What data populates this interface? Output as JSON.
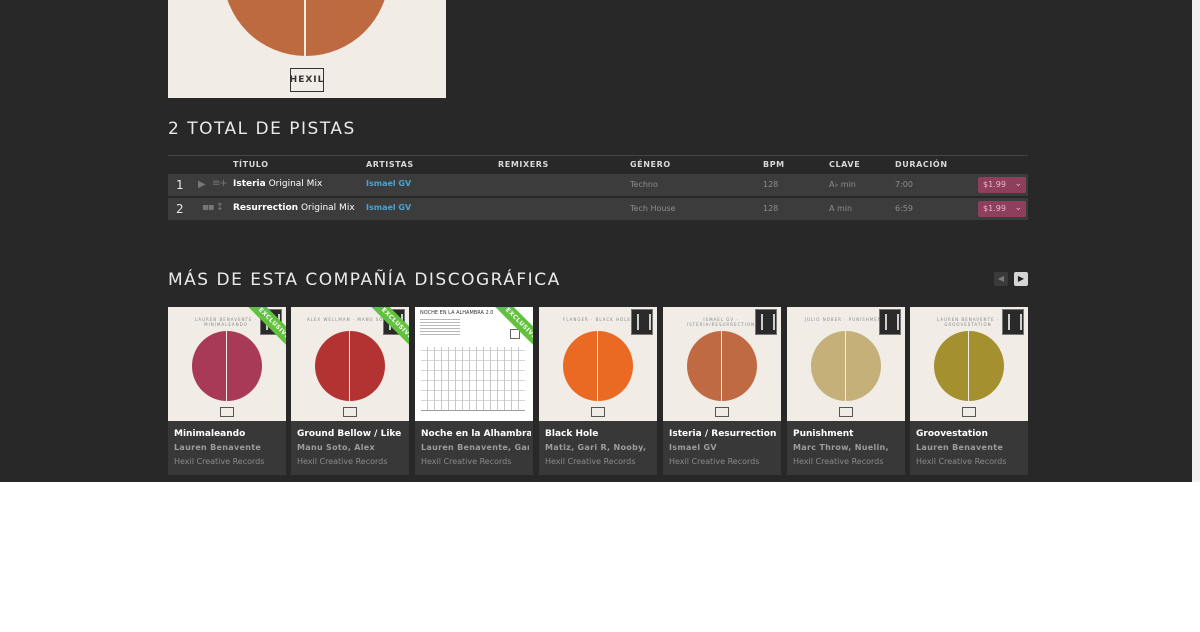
{
  "hero": {
    "logo_text": "HEXIL"
  },
  "tracks_section": {
    "title": "2 TOTAL DE PISTAS"
  },
  "table": {
    "headers": {
      "title": "TÍTULO",
      "artists": "ARTISTAS",
      "remixers": "REMIXERS",
      "genre": "GÉNERO",
      "bpm": "BPM",
      "key": "CLAVE",
      "duration": "DURACIÓN"
    },
    "rows": [
      {
        "num": "1",
        "name": "Isteria",
        "mix": "Original Mix",
        "artist": "Ismael GV",
        "genre": "Techno",
        "bpm": "128",
        "key": "A♭ min",
        "duration": "7:00",
        "price": "$1.99"
      },
      {
        "num": "2",
        "name": "Resurrection",
        "mix": "Original Mix",
        "artist": "Ismael GV",
        "genre": "Tech House",
        "bpm": "128",
        "key": "A min",
        "duration": "6:59",
        "price": "$1.99"
      }
    ]
  },
  "label_section": {
    "title": "MÁS DE ESTA COMPAÑÍA DISCOGRÁFICA"
  },
  "releases": [
    {
      "title": "Minimaleando",
      "artist": "Lauren Benavente",
      "label": "Hexil Creative Records",
      "cover_tag": "LAUREN BENAVENTE · MINIMALEANDO",
      "ribbon": "EXCLUSIVE",
      "disc_color": "#a83a58"
    },
    {
      "title": "Ground Bellow / Like",
      "artist": "Manu Soto, Alex",
      "label": "Hexil Creative Records",
      "cover_tag": "ALEX WELLMAN · MANU SOTO",
      "ribbon": "EXCLUSIVE",
      "disc_color": "#b33232"
    },
    {
      "title": "Noche en la Alhambra",
      "artist": "Lauren Benavente, Gari",
      "label": "Hexil Creative Records",
      "cover_tag": "NOCHE EN LA ALHAMBRA 2.0",
      "ribbon": "EXCLUSIVE",
      "disc_color": "#ffffff"
    },
    {
      "title": "Black Hole",
      "artist": "Matiz, Gari R, Nooby,",
      "label": "Hexil Creative Records",
      "cover_tag": "FLANGER · BLACK HOLE",
      "ribbon": "",
      "disc_color": "#ea6a24"
    },
    {
      "title": "Isteria / Resurrection",
      "artist": "Ismael GV",
      "label": "Hexil Creative Records",
      "cover_tag": "ISMAEL GV · ISTERIA/RESURRECTION",
      "ribbon": "",
      "disc_color": "#bf6a42"
    },
    {
      "title": "Punishment",
      "artist": "Marc Throw, Nuelin,",
      "label": "Hexil Creative Records",
      "cover_tag": "JULIO NOBER · PUNISHMENT",
      "ribbon": "",
      "disc_color": "#c4b078"
    },
    {
      "title": "Groovestation",
      "artist": "Lauren Benavente",
      "label": "Hexil Creative Records",
      "cover_tag": "LAUREN BENAVENTE · GROOVESTATION",
      "ribbon": "",
      "disc_color": "#a4902e"
    }
  ],
  "icons": {
    "play": "play-icon",
    "queue": "add-to-queue-icon",
    "price_menu": "chevron-down-icon",
    "prev": "chevron-left-icon",
    "next": "chevron-right-icon"
  },
  "colors": {
    "background": "#282828",
    "row": "#3c3c3c",
    "artist_link": "#4aa3d6",
    "price": "#8d3f5c",
    "exclusive": "#62c23d"
  }
}
